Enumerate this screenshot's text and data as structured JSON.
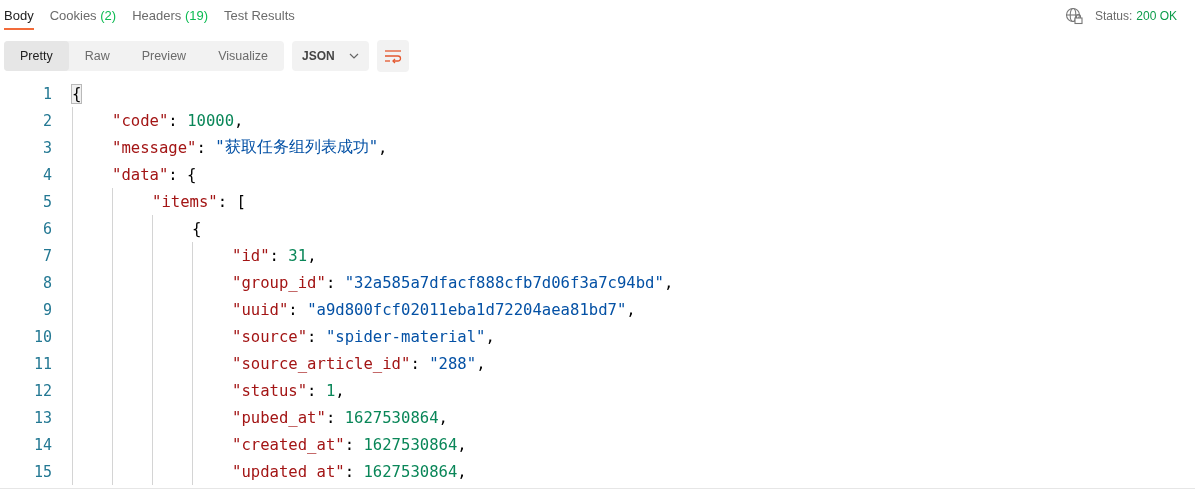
{
  "tabs": [
    {
      "label": "Body",
      "selected": true
    },
    {
      "label": "Cookies",
      "count": "(2)",
      "selected": false
    },
    {
      "label": "Headers",
      "count": "(19)",
      "selected": false
    },
    {
      "label": "Test Results",
      "selected": false
    }
  ],
  "status": {
    "label": "Status:",
    "value": "200 OK"
  },
  "view_modes": [
    {
      "label": "Pretty",
      "selected": true
    },
    {
      "label": "Raw",
      "selected": false
    },
    {
      "label": "Preview",
      "selected": false
    },
    {
      "label": "Visualize",
      "selected": false
    }
  ],
  "format_dropdown": {
    "value": "JSON"
  },
  "editor": {
    "lines": [
      {
        "number": "1",
        "tokens": [
          {
            "kind": "punct",
            "text": "{",
            "highlight": true
          }
        ],
        "children": [
          {
            "number": "2",
            "tokens": [
              {
                "kind": "key",
                "text": "\"code\""
              },
              {
                "kind": "punct",
                "text": ": "
              },
              {
                "kind": "number",
                "text": "10000"
              },
              {
                "kind": "punct",
                "text": ","
              }
            ]
          },
          {
            "number": "3",
            "tokens": [
              {
                "kind": "key",
                "text": "\"message\""
              },
              {
                "kind": "punct",
                "text": ": "
              },
              {
                "kind": "string",
                "text": "\"获取任务组列表成功\""
              },
              {
                "kind": "punct",
                "text": ","
              }
            ]
          },
          {
            "number": "4",
            "tokens": [
              {
                "kind": "key",
                "text": "\"data\""
              },
              {
                "kind": "punct",
                "text": ": {"
              }
            ],
            "children": [
              {
                "number": "5",
                "tokens": [
                  {
                    "kind": "key",
                    "text": "\"items\""
                  },
                  {
                    "kind": "punct",
                    "text": ": ["
                  }
                ],
                "children": [
                  {
                    "number": "6",
                    "tokens": [
                      {
                        "kind": "punct",
                        "text": "{"
                      }
                    ],
                    "children": [
                      {
                        "number": "7",
                        "tokens": [
                          {
                            "kind": "key",
                            "text": "\"id\""
                          },
                          {
                            "kind": "punct",
                            "text": ": "
                          },
                          {
                            "kind": "number",
                            "text": "31"
                          },
                          {
                            "kind": "punct",
                            "text": ","
                          }
                        ]
                      },
                      {
                        "number": "8",
                        "tokens": [
                          {
                            "kind": "key",
                            "text": "\"group_id\""
                          },
                          {
                            "kind": "punct",
                            "text": ": "
                          },
                          {
                            "kind": "string",
                            "text": "\"32a585a7dfacf888cfb7d06f3a7c94bd\""
                          },
                          {
                            "kind": "punct",
                            "text": ","
                          }
                        ]
                      },
                      {
                        "number": "9",
                        "tokens": [
                          {
                            "kind": "key",
                            "text": "\"uuid\""
                          },
                          {
                            "kind": "punct",
                            "text": ": "
                          },
                          {
                            "kind": "string",
                            "text": "\"a9d800fcf02011eba1d72204aea81bd7\""
                          },
                          {
                            "kind": "punct",
                            "text": ","
                          }
                        ]
                      },
                      {
                        "number": "10",
                        "tokens": [
                          {
                            "kind": "key",
                            "text": "\"source\""
                          },
                          {
                            "kind": "punct",
                            "text": ": "
                          },
                          {
                            "kind": "string",
                            "text": "\"spider-material\""
                          },
                          {
                            "kind": "punct",
                            "text": ","
                          }
                        ]
                      },
                      {
                        "number": "11",
                        "tokens": [
                          {
                            "kind": "key",
                            "text": "\"source_article_id\""
                          },
                          {
                            "kind": "punct",
                            "text": ": "
                          },
                          {
                            "kind": "string",
                            "text": "\"288\""
                          },
                          {
                            "kind": "punct",
                            "text": ","
                          }
                        ]
                      },
                      {
                        "number": "12",
                        "tokens": [
                          {
                            "kind": "key",
                            "text": "\"status\""
                          },
                          {
                            "kind": "punct",
                            "text": ": "
                          },
                          {
                            "kind": "number",
                            "text": "1"
                          },
                          {
                            "kind": "punct",
                            "text": ","
                          }
                        ]
                      },
                      {
                        "number": "13",
                        "tokens": [
                          {
                            "kind": "key",
                            "text": "\"pubed_at\""
                          },
                          {
                            "kind": "punct",
                            "text": ": "
                          },
                          {
                            "kind": "number",
                            "text": "1627530864"
                          },
                          {
                            "kind": "punct",
                            "text": ","
                          }
                        ]
                      },
                      {
                        "number": "14",
                        "tokens": [
                          {
                            "kind": "key",
                            "text": "\"created_at\""
                          },
                          {
                            "kind": "punct",
                            "text": ": "
                          },
                          {
                            "kind": "number",
                            "text": "1627530864"
                          },
                          {
                            "kind": "punct",
                            "text": ","
                          }
                        ]
                      },
                      {
                        "number": "15",
                        "tokens": [
                          {
                            "kind": "key",
                            "text": "\"updated at\""
                          },
                          {
                            "kind": "punct",
                            "text": ": "
                          },
                          {
                            "kind": "number",
                            "text": "1627530864"
                          },
                          {
                            "kind": "punct",
                            "text": ","
                          }
                        ]
                      }
                    ]
                  }
                ]
              }
            ]
          }
        ]
      }
    ]
  }
}
